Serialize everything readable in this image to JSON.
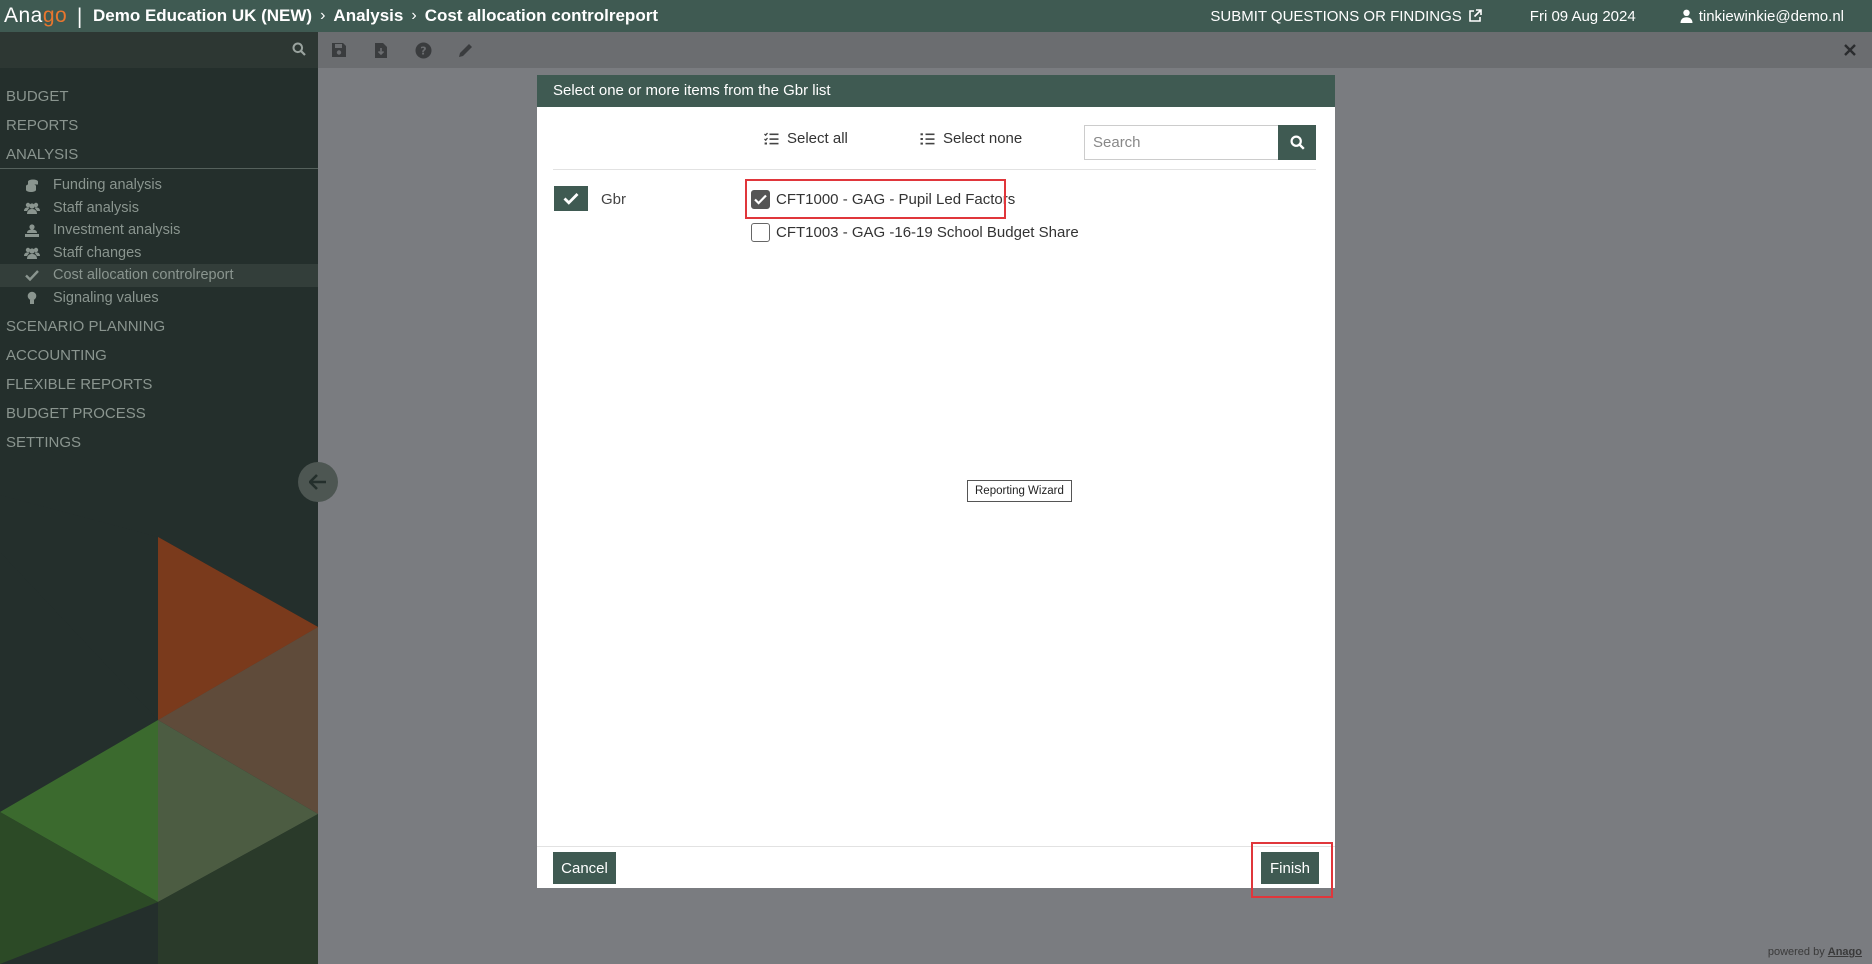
{
  "app": {
    "logo_main": "Ana",
    "logo_accent": "go",
    "logo_separator": "|",
    "breadcrumb": [
      "Demo Education UK (NEW)",
      "Analysis",
      "Cost allocation controlreport"
    ],
    "breadcrumb_separator": "›",
    "submit_link": "SUBMIT QUESTIONS OR FINDINGS",
    "date": "Fri 09 Aug 2024",
    "user": "tinkiewinkie@demo.nl"
  },
  "toolbar": {
    "icons": [
      "save-icon",
      "download-icon",
      "help-icon",
      "edit-icon"
    ],
    "close_icon": "close-icon"
  },
  "sidebar": {
    "groups_top": [
      {
        "label": "BUDGET"
      },
      {
        "label": "REPORTS"
      },
      {
        "label": "ANALYSIS",
        "open": true
      }
    ],
    "analysis_items": [
      {
        "label": "Funding analysis",
        "icon": "coins-icon"
      },
      {
        "label": "Staff analysis",
        "icon": "users-icon"
      },
      {
        "label": "Investment analysis",
        "icon": "user-hand-icon"
      },
      {
        "label": "Staff changes",
        "icon": "users-icon"
      },
      {
        "label": "Cost allocation controlreport",
        "icon": "check-icon",
        "active": true
      },
      {
        "label": "Signaling values",
        "icon": "lightbulb-icon"
      }
    ],
    "groups_bottom": [
      {
        "label": "SCENARIO PLANNING"
      },
      {
        "label": "ACCOUNTING"
      },
      {
        "label": "FLEXIBLE REPORTS"
      },
      {
        "label": "BUDGET PROCESS"
      },
      {
        "label": "SETTINGS"
      }
    ],
    "colors": {
      "bg": "#242f2c",
      "orange": "#8a3d1f",
      "green": "#3f6b32"
    }
  },
  "modal": {
    "title": "Select one or more items from the Gbr list",
    "select_all": "Select all",
    "select_none": "Select none",
    "search_placeholder": "Search",
    "search_value": "",
    "group_label": "Gbr",
    "items": [
      {
        "label": "CFT1000 - GAG - Pupil Led Factors",
        "checked": true
      },
      {
        "label": "CFT1003 - GAG -16-19 School Budget Share",
        "checked": false
      }
    ],
    "tooltip": "Reporting Wizard",
    "cancel": "Cancel",
    "finish": "Finish"
  },
  "footer": {
    "powered_by": "powered by",
    "brand": "Anago"
  },
  "colors": {
    "primary": "#3f5a52",
    "highlight": "#e0363b",
    "overlay": "#7a7c80"
  }
}
